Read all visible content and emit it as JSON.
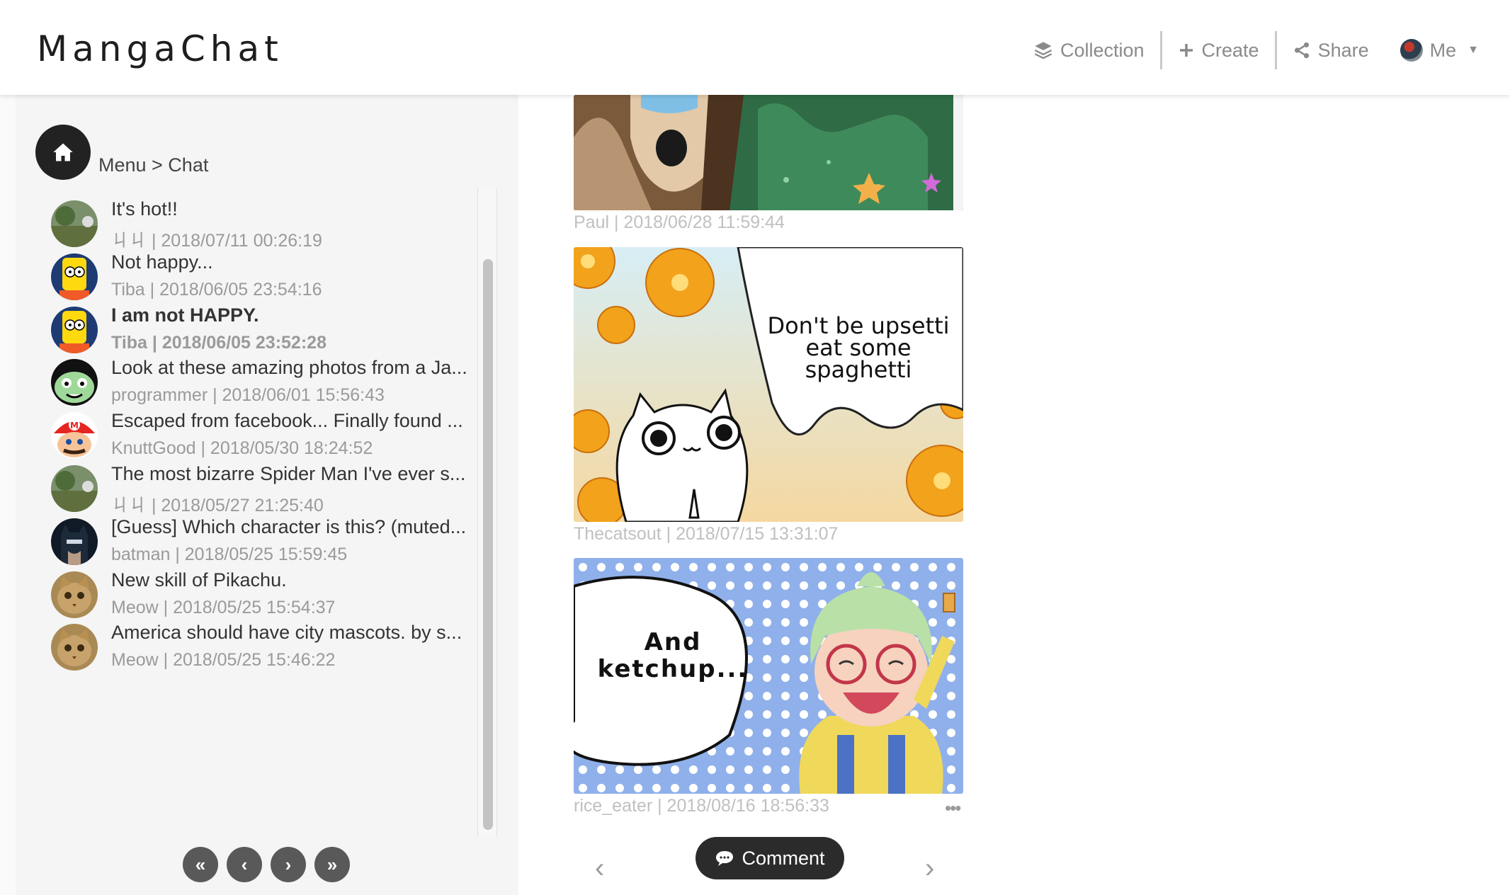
{
  "header": {
    "logo": "MangaChat",
    "nav": {
      "collection": "Collection",
      "create": "Create",
      "share": "Share",
      "me": "Me"
    }
  },
  "sidebar": {
    "breadcrumb": "Menu > Chat",
    "chats": [
      {
        "title": "It's hot!!",
        "meta": "ㄐㄐ | 2018/07/11 00:26:19",
        "avatar": "landscape-avatar",
        "bold": false
      },
      {
        "title": "Not happy...",
        "meta": "Tiba | 2018/06/05 23:54:16",
        "avatar": "bart-avatar",
        "bold": false
      },
      {
        "title": "I am not HAPPY.",
        "meta": "Tiba | 2018/06/05 23:52:28",
        "avatar": "bart-avatar",
        "bold": true
      },
      {
        "title": "Look at these amazing photos from a Ja...",
        "meta": "programmer | 2018/06/01 15:56:43",
        "avatar": "cartoon-face-avatar",
        "bold": false
      },
      {
        "title": "Escaped from facebook... Finally found ...",
        "meta": "KnuttGood | 2018/05/30 18:24:52",
        "avatar": "mario-avatar",
        "bold": false
      },
      {
        "title": "The most bizarre Spider Man I've ever s...",
        "meta": "ㄐㄐ | 2018/05/27 21:25:40",
        "avatar": "landscape-avatar",
        "bold": false
      },
      {
        "title": "[Guess] Which character is this? (muted...",
        "meta": "batman | 2018/05/25 15:59:45",
        "avatar": "batman-avatar",
        "bold": false
      },
      {
        "title": "New skill of Pikachu.",
        "meta": "Meow | 2018/05/25 15:54:37",
        "avatar": "cat-avatar",
        "bold": false
      },
      {
        "title": "America should have city mascots. by s...",
        "meta": "Meow | 2018/05/25 15:46:22",
        "avatar": "cat-avatar",
        "bold": false
      }
    ],
    "pager": {
      "first": "«",
      "prev": "‹",
      "next": "›",
      "last": "»"
    }
  },
  "feed": {
    "posts": [
      {
        "caption": "Paul | 2018/06/28 11:59:44"
      },
      {
        "caption": "Thecatsout | 2018/07/15 13:31:07",
        "bubble": "Don't be upsetti eat some spaghetti"
      },
      {
        "caption": "rice_eater | 2018/08/16 18:56:33",
        "bubble": "And ketchup..."
      }
    ],
    "more": "•••",
    "comment_button": "Comment",
    "prev_arrow": "‹",
    "next_arrow": "›"
  },
  "colors": {
    "sidebar_bg": "#f5f5f5",
    "dark_button": "#2b2b2b",
    "pager_button": "#595959",
    "muted_text": "#9a9a9a"
  }
}
